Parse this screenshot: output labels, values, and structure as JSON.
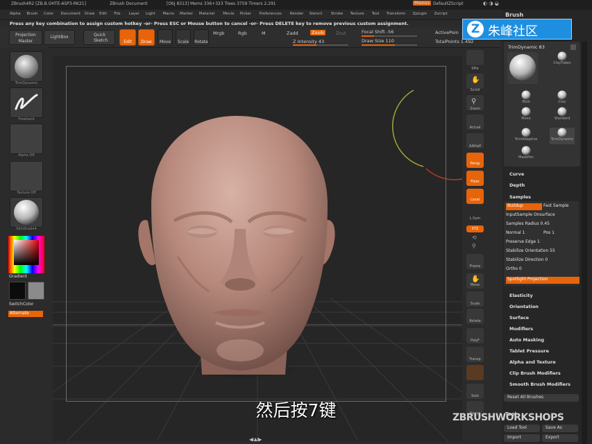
{
  "window": {
    "app_title": "ZBrush4R2 [ZB.B.OHTE-ASP3-RK21]",
    "document": "ZBrush Document",
    "stats": "[Obj 8313] Mems 336+323 Trees 3759 Timers 2.291",
    "menus_chip": "Menus",
    "script_label": "DefaultZScript"
  },
  "menubar": {
    "items": [
      "Alpha",
      "Brush",
      "Color",
      "Document",
      "Draw",
      "Edit",
      "File",
      "Layer",
      "Light",
      "Macro",
      "Marker",
      "Material",
      "Movie",
      "Picker",
      "Preferences",
      "Render",
      "Stencil",
      "Stroke",
      "Texture",
      "Tool",
      "Transform",
      "Zplugin",
      "Zscript"
    ]
  },
  "hotkey_message": "Press any key combination to assign custom hotkey -or- Press ESC or Mouse button to cancel -or- Press DELETE key to remove previous custom assignment.",
  "shelf": {
    "projection_master": "Projection Master",
    "lightbox": "LightBox",
    "quick_sketch": "Quick Sketch",
    "edit": "Edit",
    "draw": "Draw",
    "move": "Move",
    "scale": "Scale",
    "rotate": "Rotate",
    "mrgb": "Mrgb",
    "rgb": "Rgb",
    "m": "M",
    "zadd": "Zadd",
    "zsub": "Zsub",
    "zcut": "Zcut",
    "z_intensity": "Z Intensity 43",
    "focal_shift": "Focal Shift -56",
    "draw_size": "Draw Size 110",
    "active_points": "ActivePoin",
    "total_points": "TotalPoints 1.492"
  },
  "left_tray": {
    "captions": [
      "TrimDynamic",
      "Freehand",
      "Alpha Off",
      "Texture Off",
      "SkinShade4"
    ],
    "gradient": "Gradient",
    "switch_color": "SwitchColor",
    "alternate": "Alternate"
  },
  "right_toolbar": {
    "labels": [
      "SPix",
      "Scroll",
      "Zoom",
      "Actual",
      "AAHalf",
      "Persp",
      "Floor",
      "Local",
      "L.Sym",
      "XYZ",
      "Frame",
      "Move",
      "Scale",
      "Rotate",
      "PolyF",
      "Transp",
      "Solo",
      "Xpose"
    ]
  },
  "brush_palette": {
    "title": "Brush",
    "current_brush": "TrimDynamic 83",
    "brushes": [
      "ClayTubes",
      "Blob",
      "Clay",
      "Move",
      "Standard",
      "TrimAdaptive",
      "TrimDynamic",
      "MaskPen"
    ],
    "sections_top": [
      "Curve",
      "Depth",
      "Samples"
    ],
    "samples": {
      "buildup": "Buildup",
      "fast_sample": "Fast Sample",
      "input_sample": "InputSample Onsurface",
      "samples_radius": "Samples Radius 0.45",
      "normal": "Normal 1",
      "pos": "Pos 1",
      "preserve_edge": "Preserve Edge 1",
      "stabilize_orientation": "Stabilize Orientation 55",
      "stabilize_direction": "Stabilize Direction 0",
      "ortho": "Ortho 0",
      "spotlight_projection": "Spotlight Projection"
    },
    "sections_bottom": [
      "Elasticity",
      "Orientation",
      "Surface",
      "Modifiers",
      "Auto Masking",
      "Tablet Pressure",
      "Alpha and Texture",
      "Clip Brush Modifiers",
      "Smooth Brush Modifiers"
    ],
    "reset_all": "Reset All Brushes",
    "tool_title": "Tool",
    "load_tool": "Load Tool",
    "save_as": "Save As",
    "import": "Import",
    "export": "Export"
  },
  "overlay": {
    "logo_letter": "Z",
    "logo_text": "朱峰社区",
    "subtitle": "然后按7键",
    "watermark": "ZBRUSHWORKSHOPS"
  },
  "colors": {
    "accent": "#e8640a",
    "panel": "#262626",
    "logo_blue": "#1e8fe0"
  }
}
